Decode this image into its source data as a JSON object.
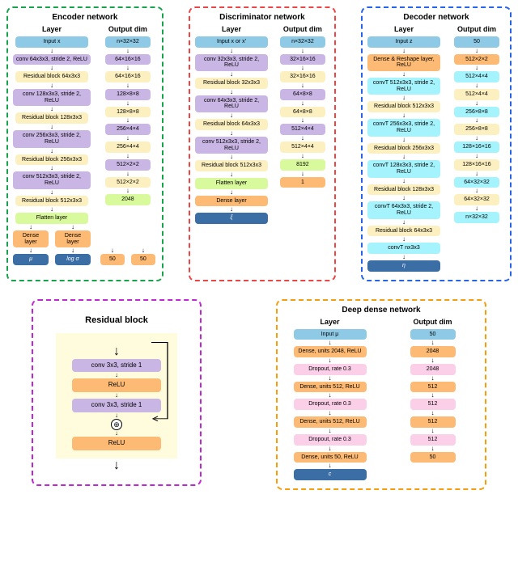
{
  "encoder": {
    "title": "Encoder network",
    "hdr_layer": "Layer",
    "hdr_dim": "Output dim",
    "rows": [
      {
        "layer": "Input x",
        "dim": "n×32×32",
        "lcls": "c-blue",
        "dcls": "c-blue"
      },
      {
        "layer": "conv 64x3x3, stride 2, ReLU",
        "dim": "64×16×16",
        "lcls": "c-purple",
        "dcls": "c-purple"
      },
      {
        "layer": "Residual block 64x3x3",
        "dim": "64×16×16",
        "lcls": "c-cream",
        "dcls": "c-cream"
      },
      {
        "layer": "conv 128x3x3, stride 2, ReLU",
        "dim": "128×8×8",
        "lcls": "c-purple",
        "dcls": "c-purple"
      },
      {
        "layer": "Residual block 128x3x3",
        "dim": "128×8×8",
        "lcls": "c-cream",
        "dcls": "c-cream"
      },
      {
        "layer": "conv 256x3x3, stride 2, ReLU",
        "dim": "256×4×4",
        "lcls": "c-purple",
        "dcls": "c-purple"
      },
      {
        "layer": "Residual block 256x3x3",
        "dim": "256×4×4",
        "lcls": "c-cream",
        "dcls": "c-cream"
      },
      {
        "layer": "conv 512x3x3, stride 2, ReLU",
        "dim": "512×2×2",
        "lcls": "c-purple",
        "dcls": "c-purple"
      },
      {
        "layer": "Residual block 512x3x3",
        "dim": "512×2×2",
        "lcls": "c-cream",
        "dcls": "c-cream"
      },
      {
        "layer": "Flatten layer",
        "dim": "2048",
        "lcls": "c-lime",
        "dcls": "c-lime"
      }
    ],
    "split": {
      "left": {
        "layer": "Dense layer",
        "dim": "50",
        "out": "μ"
      },
      "right": {
        "layer": "Dense layer",
        "dim": "50",
        "out": "log σ"
      }
    }
  },
  "discriminator": {
    "title": "Discriminator network",
    "hdr_layer": "Layer",
    "hdr_dim": "Output dim",
    "rows": [
      {
        "layer": "Input x or x'",
        "dim": "n×32×32",
        "lcls": "c-blue",
        "dcls": "c-blue"
      },
      {
        "layer": "conv 32x3x3, stride 2, ReLU",
        "dim": "32×16×16",
        "lcls": "c-purple",
        "dcls": "c-purple"
      },
      {
        "layer": "Residual block 32x3x3",
        "dim": "32×16×16",
        "lcls": "c-cream",
        "dcls": "c-cream"
      },
      {
        "layer": "conv 64x3x3, stride 2, ReLU",
        "dim": "64×8×8",
        "lcls": "c-purple",
        "dcls": "c-purple"
      },
      {
        "layer": "Residual block 64x3x3",
        "dim": "64×8×8",
        "lcls": "c-cream",
        "dcls": "c-cream"
      },
      {
        "layer": "conv 512x3x3, stride 2, ReLU",
        "dim": "512×4×4",
        "lcls": "c-purple",
        "dcls": "c-purple"
      },
      {
        "layer": "Residual block 512x3x3",
        "dim": "512×4×4",
        "lcls": "c-cream",
        "dcls": "c-cream"
      },
      {
        "layer": "Flatten layer",
        "dim": "8192",
        "lcls": "c-lime",
        "dcls": "c-lime"
      },
      {
        "layer": "Dense layer",
        "dim": "1",
        "lcls": "c-orange",
        "dcls": "c-orange"
      }
    ],
    "out": "ξ"
  },
  "decoder": {
    "title": "Decoder network",
    "hdr_layer": "Layer",
    "hdr_dim": "Output dim",
    "rows": [
      {
        "layer": "Input z",
        "dim": "50",
        "lcls": "c-blue",
        "dcls": "c-blue"
      },
      {
        "layer": "Dense & Reshape layer, ReLU",
        "dim": "512×2×2",
        "lcls": "c-orange",
        "dcls": "c-orange"
      },
      {
        "layer": "convT 512x3x3, stride 2, ReLU",
        "dim": "512×4×4",
        "lcls": "c-cyan",
        "dcls": "c-cyan"
      },
      {
        "layer": "Residual block 512x3x3",
        "dim": "512×4×4",
        "lcls": "c-cream",
        "dcls": "c-cream"
      },
      {
        "layer": "convT 256x3x3, stride 2, ReLU",
        "dim": "256×8×8",
        "lcls": "c-cyan",
        "dcls": "c-cyan"
      },
      {
        "layer": "Residual block 256x3x3",
        "dim": "256×8×8",
        "lcls": "c-cream",
        "dcls": "c-cream"
      },
      {
        "layer": "convT 128x3x3, stride 2, ReLU",
        "dim": "128×16×16",
        "lcls": "c-cyan",
        "dcls": "c-cyan"
      },
      {
        "layer": "Residual block 128x3x3",
        "dim": "128×16×16",
        "lcls": "c-cream",
        "dcls": "c-cream"
      },
      {
        "layer": "convT 64x3x3, stride 2, ReLU",
        "dim": "64×32×32",
        "lcls": "c-cyan",
        "dcls": "c-cyan"
      },
      {
        "layer": "Residual block 64x3x3",
        "dim": "64×32×32",
        "lcls": "c-cream",
        "dcls": "c-cream"
      },
      {
        "layer": "convT nx3x3",
        "dim": "n×32×32",
        "lcls": "c-cyan",
        "dcls": "c-cyan"
      }
    ],
    "out": "η"
  },
  "residual": {
    "title": "Residual block",
    "steps": [
      {
        "text": "conv 3x3, stride 1",
        "cls": "c-purple"
      },
      {
        "text": "ReLU",
        "cls": "c-orange"
      },
      {
        "text": "conv 3x3, stride 1",
        "cls": "c-purple"
      }
    ],
    "add_symbol": "⊕",
    "relu": "ReLU"
  },
  "dense": {
    "title": "Deep dense network",
    "hdr_layer": "Layer",
    "hdr_dim": "Output dim",
    "rows": [
      {
        "layer": "Input μ",
        "dim": "50",
        "lcls": "c-blue",
        "dcls": "c-blue"
      },
      {
        "layer": "Dense, units 2048, ReLU",
        "dim": "2048",
        "lcls": "c-orange",
        "dcls": "c-orange"
      },
      {
        "layer": "Dropout, rate 0.3",
        "dim": "2048",
        "lcls": "c-pink",
        "dcls": "c-pink"
      },
      {
        "layer": "Dense, units 512, ReLU",
        "dim": "512",
        "lcls": "c-orange",
        "dcls": "c-orange"
      },
      {
        "layer": "Dropout, rate 0.3",
        "dim": "512",
        "lcls": "c-pink",
        "dcls": "c-pink"
      },
      {
        "layer": "Dense, units 512, ReLU",
        "dim": "512",
        "lcls": "c-orange",
        "dcls": "c-orange"
      },
      {
        "layer": "Dropout, rate 0.3",
        "dim": "512",
        "lcls": "c-pink",
        "dcls": "c-pink"
      },
      {
        "layer": "Dense, units 50, ReLU",
        "dim": "50",
        "lcls": "c-orange",
        "dcls": "c-orange"
      }
    ],
    "out": "c"
  }
}
